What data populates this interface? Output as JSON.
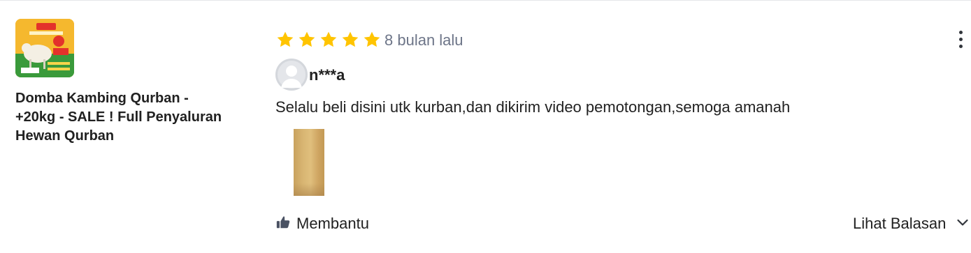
{
  "product": {
    "name": "Domba Kambing Qurban - +20kg - SALE ! Full Penyaluran Hewan Qurban",
    "thumbnail_icon": "product-thumbnail"
  },
  "review": {
    "rating": 5,
    "rating_max": 5,
    "star_color": "#ffc400",
    "time_ago": "8 bulan lalu",
    "reviewer_name": "n***a",
    "text": "Selalu beli disini utk kurban,dan dikirim video pemotongan,semoga amanah",
    "photo_count": 1
  },
  "actions": {
    "helpful_label": "Membantu",
    "replies_label": "Lihat Balasan",
    "helpful_icon": "thumbs-up-icon",
    "replies_icon": "chevron-down-icon",
    "menu_icon": "more-vertical-icon"
  }
}
